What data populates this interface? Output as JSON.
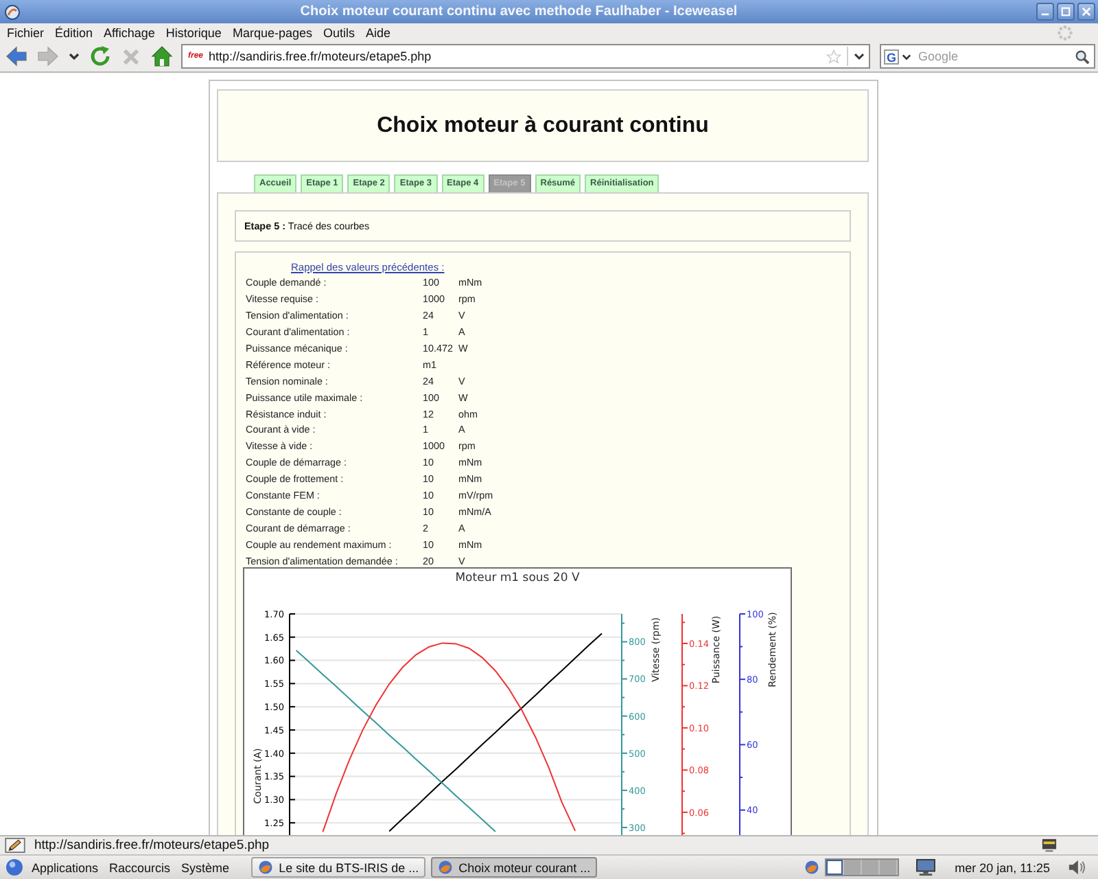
{
  "window": {
    "title": "Choix moteur courant continu avec methode Faulhaber - Iceweasel"
  },
  "menu": [
    "Fichier",
    "Édition",
    "Affichage",
    "Historique",
    "Marque-pages",
    "Outils",
    "Aide"
  ],
  "nav_buttons": [
    {
      "kind": "back",
      "disabled": false
    },
    {
      "kind": "forward",
      "disabled": true
    },
    {
      "kind": "history",
      "disabled": false
    },
    {
      "kind": "reload",
      "disabled": false
    },
    {
      "kind": "stop",
      "disabled": true
    },
    {
      "kind": "home",
      "disabled": false
    }
  ],
  "address_bar": {
    "favicon": "free",
    "value": "http://sandiris.free.fr/moteurs/etape5.php"
  },
  "search": {
    "engine": "G",
    "placeholder": "Google"
  },
  "page": {
    "heading": "Choix moteur à courant continu",
    "tabs": [
      {
        "label": "Accueil",
        "selected": false
      },
      {
        "label": "Etape 1",
        "selected": false
      },
      {
        "label": "Etape 2",
        "selected": false
      },
      {
        "label": "Etape 3",
        "selected": false
      },
      {
        "label": "Etape 4",
        "selected": false
      },
      {
        "label": "Etape 5",
        "selected": true
      },
      {
        "label": "Résumé",
        "selected": false
      },
      {
        "label": "Réinitialisation",
        "selected": false
      }
    ],
    "step": "**Etape 5 :** Tracé des courbes",
    "recall_link": "Rappel des valeurs précédentes :",
    "parameters": [
      {
        "name": "Couple demandé :",
        "value": "100",
        "unit": "mNm"
      },
      {
        "name": "Vitesse requise :",
        "value": "1000",
        "unit": "rpm"
      },
      {
        "name": "Tension d'alimentation :",
        "value": "24",
        "unit": "V"
      },
      {
        "name": "Courant d'alimentation :",
        "value": "1",
        "unit": "A"
      },
      {
        "name": "Puissance mécanique :",
        "value": "10.472",
        "unit": "W"
      },
      {
        "name": "Référence moteur :",
        "value": "m1"
      },
      {
        "name": "Tension nominale :",
        "value": "24",
        "unit": "V"
      },
      {
        "name": "Puissance utile maximale :",
        "value": "100",
        "unit": "W"
      },
      {
        "name": "Résistance induit :",
        "value": "12",
        "unit": "ohm"
      },
      {
        "name": "Courant à vide :",
        "value": "1",
        "unit": "A"
      },
      {
        "name": "Vitesse à vide :",
        "value": "1000",
        "unit": "rpm"
      },
      {
        "name": "Couple de démarrage :",
        "value": "10",
        "unit": "mNm"
      },
      {
        "name": "Couple de frottement :",
        "value": "10",
        "unit": "mNm"
      },
      {
        "name": "Constante FEM :",
        "value": "10",
        "unit": "mV/rpm"
      },
      {
        "name": "Constante de couple :",
        "value": "10",
        "unit": "mNm/A"
      },
      {
        "name": "Courant de démarrage :",
        "value": "2",
        "unit": "A"
      },
      {
        "name": "Couple au rendement maximum :",
        "value": "10",
        "unit": "mNm"
      },
      {
        "name": "Tension d'alimentation demandée :",
        "value": "20",
        "unit": "V"
      }
    ],
    "chart_data": {
      "type": "line",
      "title": "Moteur m1 sous 20 V",
      "grid": true,
      "ylabel": "Courant (A)",
      "ylim": [
        1.2,
        1.7
      ],
      "yticks": [
        {
          "value": 1.7,
          "label": "1.70"
        },
        {
          "value": 1.65,
          "label": "1.65"
        },
        {
          "value": 1.6,
          "label": "1.60"
        },
        {
          "value": 1.55,
          "label": "1.55"
        },
        {
          "value": 1.5,
          "label": "1.50"
        },
        {
          "value": 1.45,
          "label": "1.45"
        },
        {
          "value": 1.4,
          "label": "1.40"
        },
        {
          "value": 1.35,
          "label": "1.35"
        },
        {
          "value": 1.3,
          "label": "1.30"
        },
        {
          "value": 1.25,
          "label": "1.25"
        }
      ],
      "y2label": "Vitesse (rpm)",
      "y2lim": [
        250,
        875
      ],
      "y2ticks": [
        {
          "value": 800,
          "label": "800"
        },
        {
          "value": 700,
          "label": "700"
        },
        {
          "value": 600,
          "label": "600"
        },
        {
          "value": 500,
          "label": "500"
        },
        {
          "value": 400,
          "label": "400"
        },
        {
          "value": 300,
          "label": "300"
        }
      ],
      "y3label": "Puissance (W)",
      "y3lim": [
        0.044,
        0.154
      ],
      "y3ticks": [
        {
          "value": 0.14,
          "label": "0.14"
        },
        {
          "value": 0.12,
          "label": "0.12"
        },
        {
          "value": 0.1,
          "label": "0.10"
        },
        {
          "value": 0.08,
          "label": "0.08"
        },
        {
          "value": 0.06,
          "label": "0.06"
        }
      ],
      "series": [
        {
          "color": "#000000",
          "values": [
            null,
            null,
            null,
            null,
            null,
            null,
            null,
            1.232,
            1.259,
            1.285,
            1.312,
            1.339,
            1.365,
            1.392,
            1.419,
            1.445,
            1.472,
            1.498,
            1.525,
            1.552,
            1.578,
            1.605,
            1.632,
            1.658,
            null
          ]
        },
        {
          "axis": "y2",
          "color": "#339999",
          "values": [
            777,
            745,
            712,
            680,
            647,
            614,
            582,
            549,
            517,
            484,
            452,
            419,
            386,
            354,
            321,
            289,
            null,
            null,
            null,
            null,
            null,
            null,
            null,
            null,
            null
          ]
        },
        {
          "axis": "y3",
          "color": "#ee3333",
          "values": [
            null,
            null,
            0.0507,
            0.0688,
            0.0849,
            0.0989,
            0.1108,
            0.1208,
            0.1287,
            0.1346,
            0.1384,
            0.1402,
            0.1399,
            0.1377,
            0.1333,
            0.127,
            0.1186,
            0.1082,
            0.0957,
            0.0812,
            0.0647,
            0.0512,
            null,
            null,
            null
          ]
        }
      ]
    },
    "extra_axis": {
      "label": "Rendement (%)",
      "color": "#3333dd",
      "ticks": [
        "100",
        "80",
        "60",
        "40"
      ]
    }
  },
  "status_bar": {
    "text": "http://sandiris.free.fr/moteurs/etape5.php"
  },
  "taskbar": {
    "menus": [
      "Applications",
      "Raccourcis",
      "Système"
    ],
    "tasks": [
      {
        "label": "Le site du BTS-IRIS de ...",
        "selected": false
      },
      {
        "label": "Choix moteur courant ...",
        "selected": true
      }
    ],
    "workspaces": [
      {
        "selected": true
      },
      {
        "selected": false
      },
      {
        "selected": false
      },
      {
        "selected": false
      }
    ],
    "clock": "mer 20 jan, 11:25"
  }
}
